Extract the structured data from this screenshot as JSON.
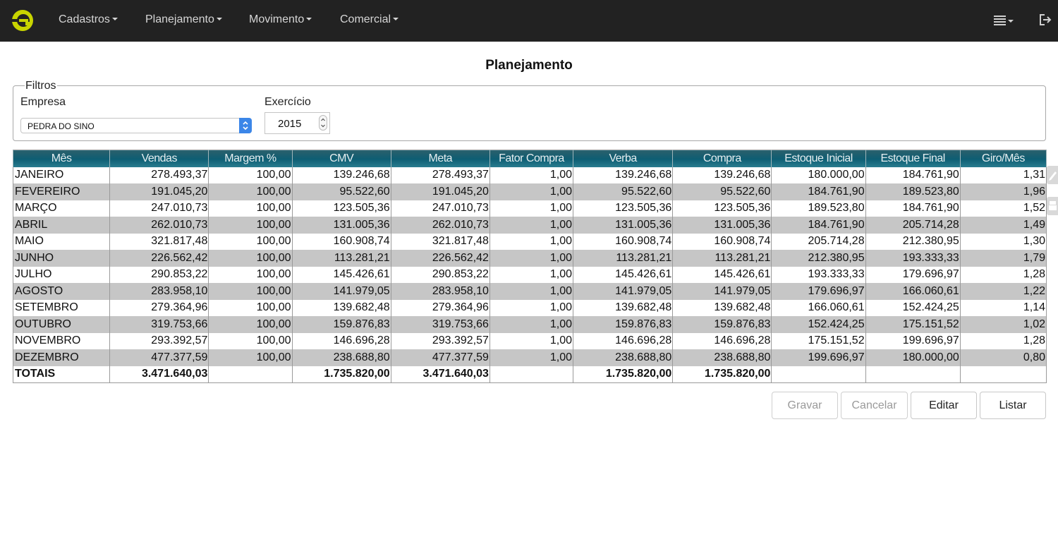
{
  "nav": {
    "items": [
      {
        "label": "Cadastros"
      },
      {
        "label": "Planejamento"
      },
      {
        "label": "Movimento"
      },
      {
        "label": "Comercial"
      }
    ],
    "logo_color": "#c8d400"
  },
  "page": {
    "title": "Planejamento"
  },
  "filters": {
    "legend": "Filtros",
    "empresa_label": "Empresa",
    "empresa_value": "PEDRA DO SINO",
    "exercicio_label": "Exercício",
    "exercicio_value": "2015"
  },
  "table": {
    "headers": [
      "Mês",
      "Vendas",
      "Margem %",
      "CMV",
      "Meta",
      "Fator Compra",
      "Verba",
      "Compra",
      "Estoque Inicial",
      "Estoque Final",
      "Giro/Mês"
    ],
    "rows": [
      [
        "JANEIRO",
        "278.493,37",
        "100,00",
        "139.246,68",
        "278.493,37",
        "1,00",
        "139.246,68",
        "139.246,68",
        "180.000,00",
        "184.761,90",
        "1,31"
      ],
      [
        "FEVEREIRO",
        "191.045,20",
        "100,00",
        "95.522,60",
        "191.045,20",
        "1,00",
        "95.522,60",
        "95.522,60",
        "184.761,90",
        "189.523,80",
        "1,96"
      ],
      [
        "MARÇO",
        "247.010,73",
        "100,00",
        "123.505,36",
        "247.010,73",
        "1,00",
        "123.505,36",
        "123.505,36",
        "189.523,80",
        "184.761,90",
        "1,52"
      ],
      [
        "ABRIL",
        "262.010,73",
        "100,00",
        "131.005,36",
        "262.010,73",
        "1,00",
        "131.005,36",
        "131.005,36",
        "184.761,90",
        "205.714,28",
        "1,49"
      ],
      [
        "MAIO",
        "321.817,48",
        "100,00",
        "160.908,74",
        "321.817,48",
        "1,00",
        "160.908,74",
        "160.908,74",
        "205.714,28",
        "212.380,95",
        "1,30"
      ],
      [
        "JUNHO",
        "226.562,42",
        "100,00",
        "113.281,21",
        "226.562,42",
        "1,00",
        "113.281,21",
        "113.281,21",
        "212.380,95",
        "193.333,33",
        "1,79"
      ],
      [
        "JULHO",
        "290.853,22",
        "100,00",
        "145.426,61",
        "290.853,22",
        "1,00",
        "145.426,61",
        "145.426,61",
        "193.333,33",
        "179.696,97",
        "1,28"
      ],
      [
        "AGOSTO",
        "283.958,10",
        "100,00",
        "141.979,05",
        "283.958,10",
        "1,00",
        "141.979,05",
        "141.979,05",
        "179.696,97",
        "166.060,61",
        "1,22"
      ],
      [
        "SETEMBRO",
        "279.364,96",
        "100,00",
        "139.682,48",
        "279.364,96",
        "1,00",
        "139.682,48",
        "139.682,48",
        "166.060,61",
        "152.424,25",
        "1,14"
      ],
      [
        "OUTUBRO",
        "319.753,66",
        "100,00",
        "159.876,83",
        "319.753,66",
        "1,00",
        "159.876,83",
        "159.876,83",
        "152.424,25",
        "175.151,52",
        "1,02"
      ],
      [
        "NOVEMBRO",
        "293.392,57",
        "100,00",
        "146.696,28",
        "293.392,57",
        "1,00",
        "146.696,28",
        "146.696,28",
        "175.151,52",
        "199.696,97",
        "1,28"
      ],
      [
        "DEZEMBRO",
        "477.377,59",
        "100,00",
        "238.688,80",
        "477.377,59",
        "1,00",
        "238.688,80",
        "238.688,80",
        "199.696,97",
        "180.000,00",
        "0,80"
      ]
    ],
    "totals": [
      "TOTAIS",
      "3.471.640,03",
      "",
      "1.735.820,00",
      "3.471.640,03",
      "",
      "1.735.820,00",
      "1.735.820,00",
      "",
      "",
      ""
    ]
  },
  "buttons": {
    "gravar": "Gravar",
    "cancelar": "Cancelar",
    "editar": "Editar",
    "listar": "Listar"
  },
  "icons": {
    "logo": "e-logo-icon",
    "menu": "list-menu-icon",
    "logout": "logout-icon",
    "edit": "pencil-icon",
    "print": "print-icon"
  }
}
